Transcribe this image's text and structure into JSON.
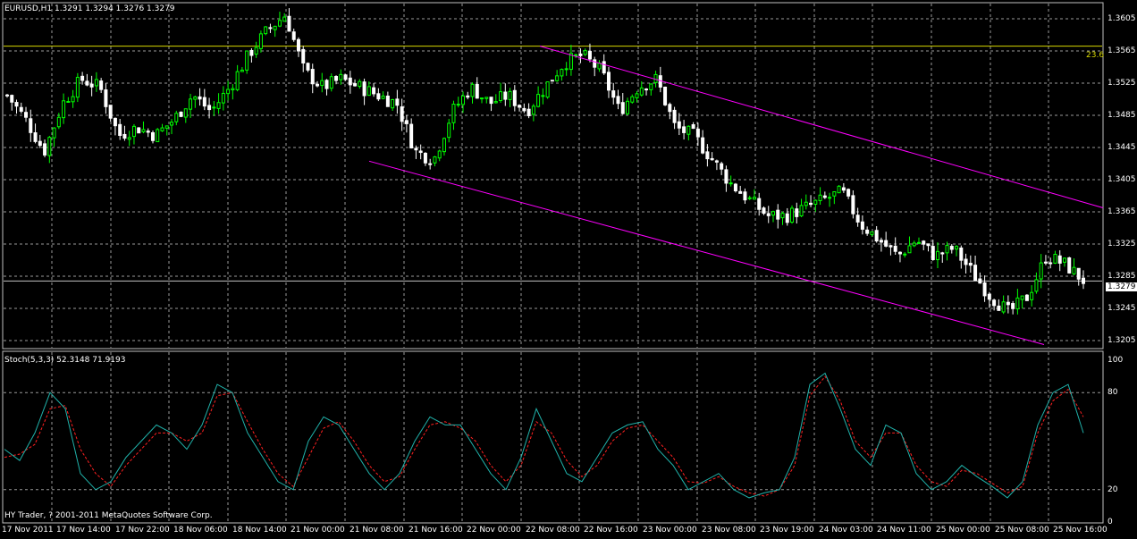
{
  "main": {
    "header": "EURUSD,H1  1.3291 1.3294 1.3276 1.3279",
    "fib_label": "23.6",
    "price_label": "1.3279",
    "current_price": 1.3279,
    "fib_level": 1.3571,
    "y_axis": [
      "1.3605",
      "1.3565",
      "1.3525",
      "1.3485",
      "1.3445",
      "1.3405",
      "1.3365",
      "1.3325",
      "1.3285",
      "1.3245",
      "1.3205"
    ]
  },
  "oscillator": {
    "header": "Stoch(5,3,3) 52.3148 71.9193",
    "y_axis": [
      "100",
      "80",
      "20",
      "0"
    ],
    "levels": [
      80,
      20
    ],
    "copyright": "HY Trader, ? 2001-2011 MetaQuotes Software Corp."
  },
  "time_axis": [
    "17 Nov 2011",
    "17 Nov 14:00",
    "17 Nov 22:00",
    "18 Nov 06:00",
    "18 Nov 14:00",
    "21 Nov 00:00",
    "21 Nov 08:00",
    "21 Nov 16:00",
    "22 Nov 00:00",
    "22 Nov 08:00",
    "22 Nov 16:00",
    "23 Nov 00:00",
    "23 Nov 08:00",
    "23 Nov 19:00",
    "24 Nov 03:00",
    "24 Nov 11:00",
    "25 Nov 00:00",
    "25 Nov 08:00",
    "25 Nov 16:00"
  ],
  "colors": {
    "bull": "#00ff00",
    "bear": "#ffffff",
    "grid": "#9a9a9a",
    "channel": "#ff00ff",
    "fib": "#d6d600",
    "k": "#20b2aa",
    "d": "#ff2020"
  },
  "chart_data": {
    "type": "candlestick",
    "symbol": "EURUSD",
    "timeframe": "H1",
    "ylim": [
      1.3195,
      1.3625
    ],
    "close_path": [
      1.351,
      1.348,
      1.344,
      1.35,
      1.353,
      1.352,
      1.346,
      1.347,
      1.346,
      1.348,
      1.351,
      1.349,
      1.352,
      1.356,
      1.359,
      1.361,
      1.354,
      1.352,
      1.353,
      1.352,
      1.351,
      1.35,
      1.344,
      1.343,
      1.349,
      1.352,
      1.35,
      1.351,
      1.349,
      1.352,
      1.355,
      1.356,
      1.354,
      1.349,
      1.352,
      1.353,
      1.347,
      1.346,
      1.343,
      1.34,
      1.338,
      1.336,
      1.336,
      1.337,
      1.338,
      1.339,
      1.335,
      1.333,
      1.331,
      1.333,
      1.331,
      1.332,
      1.329,
      1.326,
      1.324,
      1.326,
      1.331,
      1.33,
      1.328
    ],
    "channel_upper": {
      "from": [
        "22 Nov 08:00",
        1.3571
      ],
      "to": [
        "25 Nov 18:00",
        1.337
      ]
    },
    "channel_lower": {
      "from": [
        "21 Nov 08:00",
        1.3428
      ],
      "to": [
        "25 Nov 16:00",
        1.32
      ]
    },
    "stoch_k": [
      45,
      38,
      55,
      80,
      70,
      30,
      20,
      25,
      40,
      50,
      60,
      55,
      45,
      60,
      85,
      80,
      55,
      40,
      25,
      20,
      50,
      65,
      60,
      45,
      30,
      20,
      30,
      50,
      65,
      60,
      60,
      45,
      30,
      20,
      40,
      70,
      50,
      30,
      25,
      40,
      55,
      60,
      62,
      45,
      35,
      20,
      25,
      30,
      20,
      15,
      18,
      20,
      40,
      85,
      92,
      70,
      45,
      35,
      60,
      55,
      30,
      20,
      25,
      35,
      28,
      22,
      15,
      25,
      60,
      80,
      85,
      55
    ],
    "stoch_d": [
      40,
      42,
      48,
      70,
      72,
      45,
      30,
      22,
      35,
      45,
      55,
      55,
      50,
      55,
      78,
      80,
      62,
      45,
      30,
      22,
      40,
      58,
      62,
      50,
      35,
      25,
      28,
      45,
      60,
      62,
      58,
      50,
      35,
      25,
      35,
      62,
      55,
      38,
      28,
      35,
      50,
      58,
      60,
      50,
      40,
      25,
      24,
      28,
      22,
      18,
      16,
      20,
      35,
      78,
      90,
      75,
      50,
      40,
      55,
      55,
      35,
      25,
      22,
      32,
      30,
      24,
      18,
      22,
      55,
      75,
      82,
      65
    ],
    "stoch_levels": [
      80,
      20
    ]
  }
}
